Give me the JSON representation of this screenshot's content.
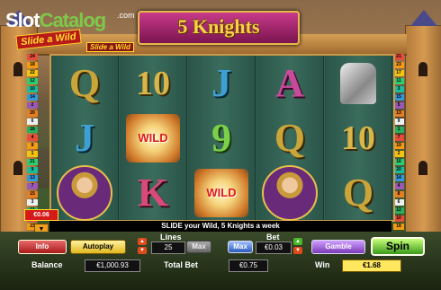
{
  "logo": {
    "brand_a": "Slot",
    "brand_b": "Catalog",
    "brand_suffix": ".com",
    "badge": "Slide a Wild",
    "badge_small": "Slide a Wild"
  },
  "game": {
    "title": "5 Knights"
  },
  "reels": [
    [
      "Q",
      "J",
      "knight"
    ],
    [
      "10",
      "wild",
      "K"
    ],
    [
      "J",
      "9",
      "wild"
    ],
    [
      "A",
      "Q",
      "knight"
    ],
    [
      "gauntlet",
      "10",
      "Q"
    ]
  ],
  "wild_label": "WILD",
  "paylines_left": [
    "24",
    "18",
    "22",
    "12",
    "10",
    "14",
    "2",
    "20",
    "6",
    "16",
    "4",
    "8",
    "1",
    "21",
    "9",
    "13",
    "7",
    "15",
    "3",
    "11",
    "17",
    "23",
    "5",
    "19",
    "25"
  ],
  "paylines_right": [
    "21",
    "23",
    "17",
    "11",
    "3",
    "15",
    "5",
    "13",
    "9",
    "1",
    "7",
    "19",
    "2",
    "16",
    "20",
    "14",
    "4",
    "8",
    "6",
    "12",
    "10",
    "18",
    "22",
    "24",
    "25"
  ],
  "win_indicator": "€0.06",
  "message": "SLIDE your Wild, 5 Knights a week",
  "controls": {
    "info": "Info",
    "autoplay": "Autoplay",
    "lines_label": "Lines",
    "lines_value": "25",
    "max_lines": "Max",
    "max_bet": "Max",
    "bet_label": "Bet",
    "bet_value": "€0.03",
    "gamble": "Gamble",
    "spin": "Spin",
    "balance_label": "Balance",
    "balance_value": "€1,000.93",
    "total_bet_label": "Total Bet",
    "total_bet_value": "€0.75",
    "win_label": "Win",
    "win_value": "€1.68"
  },
  "colors": {
    "accent": "#f8d24a",
    "title_bg": "#c83a8a",
    "reel_bg": "#2f5d4e",
    "spin": "#3a9a1a"
  }
}
